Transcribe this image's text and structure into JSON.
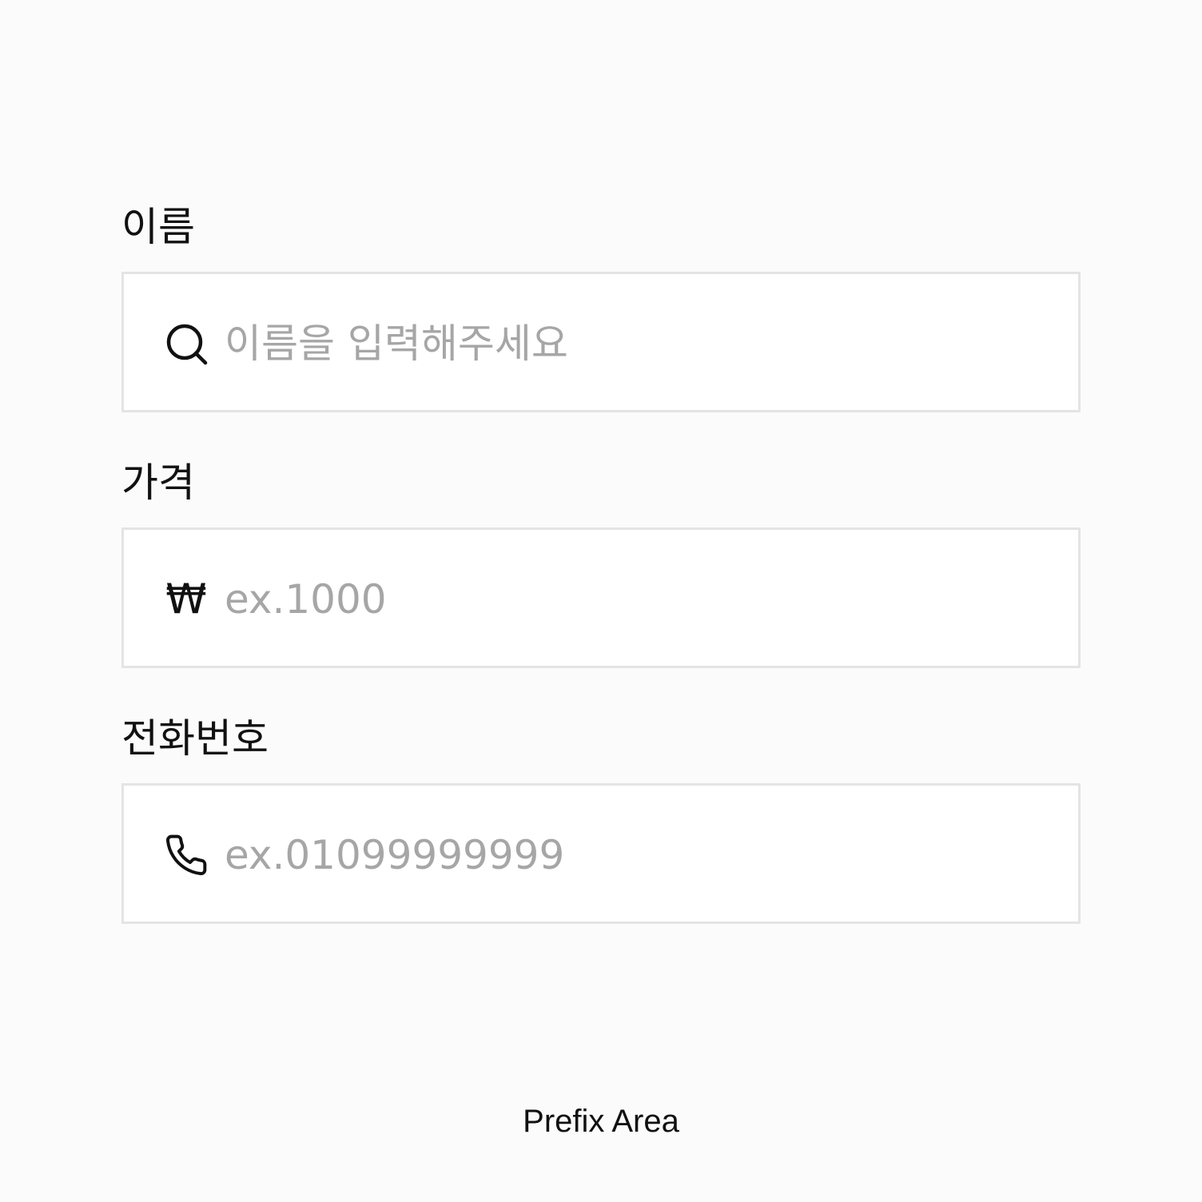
{
  "form": {
    "fields": [
      {
        "label": "이름",
        "prefix_icon": "search-icon",
        "value": "",
        "placeholder": "이름을 입력해주세요"
      },
      {
        "label": "가격",
        "prefix_icon": "won-icon",
        "prefix_text": "₩",
        "value": "",
        "placeholder": "ex.1000"
      },
      {
        "label": "전화번호",
        "prefix_icon": "phone-icon",
        "value": "",
        "placeholder": "ex.01099999999"
      }
    ]
  },
  "footer": {
    "caption": "Prefix Area"
  },
  "colors": {
    "background": "#fbfbfb",
    "input_background": "#ffffff",
    "border": "#e4e4e4",
    "text": "#111111",
    "placeholder": "#a6a6a6"
  }
}
